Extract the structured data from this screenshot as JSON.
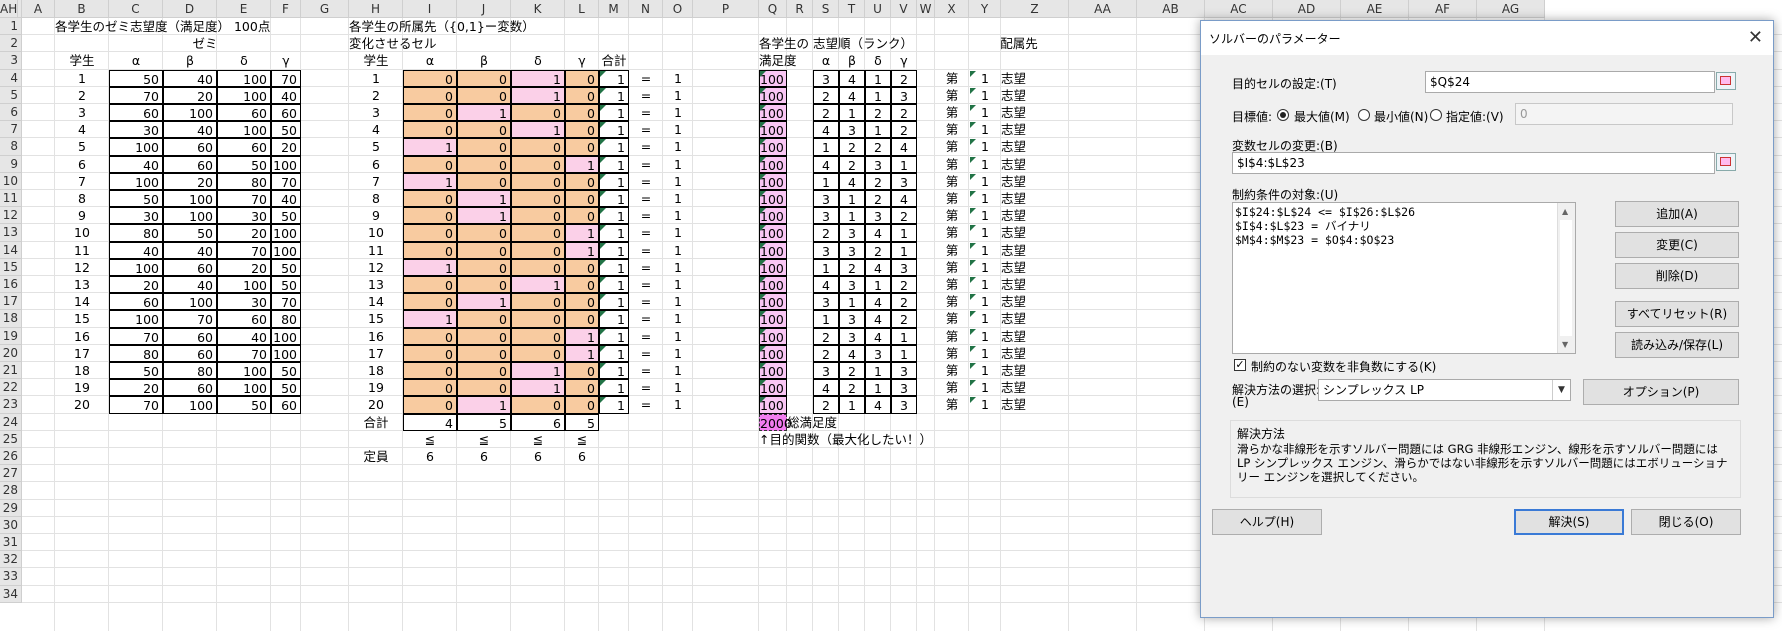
{
  "columns": [
    "A",
    "B",
    "C",
    "D",
    "E",
    "F",
    "G",
    "H",
    "I",
    "J",
    "K",
    "L",
    "M",
    "N",
    "O",
    "P",
    "Q",
    "R",
    "S",
    "T",
    "U",
    "V",
    "W",
    "X",
    "Y",
    "Z",
    "AA",
    "AB",
    "AC",
    "AD",
    "AE",
    "AF",
    "AG",
    "AH"
  ],
  "rows": [
    "1",
    "2",
    "3",
    "4",
    "5",
    "6",
    "7",
    "8",
    "9",
    "10",
    "11",
    "12",
    "13",
    "14",
    "15",
    "16",
    "17",
    "18",
    "19",
    "20",
    "21",
    "22",
    "23",
    "24",
    "25",
    "26",
    "27",
    "28",
    "29",
    "30",
    "31",
    "32",
    "33",
    "34"
  ],
  "sheet": {
    "b1_title": "各学生のゼミ志望度（満足度） 100点",
    "zemi": "ゼミ",
    "student_hdr": "学生",
    "greek": [
      "α",
      "β",
      "δ",
      "γ"
    ],
    "preference": [
      [
        50,
        40,
        100,
        70
      ],
      [
        70,
        20,
        100,
        40
      ],
      [
        60,
        100,
        60,
        60
      ],
      [
        30,
        40,
        100,
        50
      ],
      [
        100,
        60,
        60,
        20
      ],
      [
        40,
        60,
        50,
        100
      ],
      [
        100,
        20,
        80,
        70
      ],
      [
        50,
        100,
        70,
        40
      ],
      [
        30,
        100,
        30,
        50
      ],
      [
        80,
        50,
        20,
        100
      ],
      [
        40,
        40,
        70,
        100
      ],
      [
        100,
        60,
        20,
        50
      ],
      [
        20,
        40,
        100,
        50
      ],
      [
        60,
        100,
        30,
        70
      ],
      [
        100,
        70,
        60,
        80
      ],
      [
        70,
        60,
        40,
        100
      ],
      [
        80,
        60,
        70,
        100
      ],
      [
        50,
        80,
        100,
        50
      ],
      [
        20,
        60,
        100,
        50
      ],
      [
        70,
        100,
        50,
        60
      ]
    ],
    "h1_title": "各学生の所属先（{0,1}ー変数）",
    "h2_label": "変化させるセル",
    "student_hdr2": "学生",
    "goukei": "合計",
    "assignment": [
      [
        0,
        0,
        1,
        0
      ],
      [
        0,
        0,
        1,
        0
      ],
      [
        0,
        1,
        0,
        0
      ],
      [
        0,
        0,
        1,
        0
      ],
      [
        1,
        0,
        0,
        0
      ],
      [
        0,
        0,
        0,
        1
      ],
      [
        1,
        0,
        0,
        0
      ],
      [
        0,
        1,
        0,
        0
      ],
      [
        0,
        1,
        0,
        0
      ],
      [
        0,
        0,
        0,
        1
      ],
      [
        0,
        0,
        0,
        1
      ],
      [
        1,
        0,
        0,
        0
      ],
      [
        0,
        0,
        1,
        0
      ],
      [
        0,
        1,
        0,
        0
      ],
      [
        1,
        0,
        0,
        0
      ],
      [
        0,
        0,
        0,
        1
      ],
      [
        0,
        0,
        0,
        1
      ],
      [
        0,
        0,
        1,
        0
      ],
      [
        0,
        0,
        1,
        0
      ],
      [
        0,
        1,
        0,
        0
      ]
    ],
    "row_sum": "1",
    "eq": "=",
    "one": "1",
    "col_totals": [
      4,
      5,
      6,
      5
    ],
    "goukei_row": "合計",
    "le": "≦",
    "teiin": "定員",
    "capacity": [
      6,
      6,
      6,
      6
    ],
    "q2": "各学生の",
    "q3": "満足度",
    "satisfaction": "100",
    "total": "2000",
    "total_label": "総満足度",
    "objective_note": "↑目的関数（最大化したい！）",
    "s2": "志望順（ランク）",
    "rank": [
      [
        3,
        4,
        1,
        2
      ],
      [
        2,
        4,
        1,
        3
      ],
      [
        2,
        1,
        2,
        2
      ],
      [
        4,
        3,
        1,
        2
      ],
      [
        1,
        2,
        2,
        4
      ],
      [
        4,
        2,
        3,
        1
      ],
      [
        1,
        4,
        2,
        3
      ],
      [
        3,
        1,
        2,
        4
      ],
      [
        3,
        1,
        3,
        2
      ],
      [
        2,
        3,
        4,
        1
      ],
      [
        3,
        3,
        2,
        1
      ],
      [
        1,
        2,
        4,
        3
      ],
      [
        4,
        3,
        1,
        2
      ],
      [
        3,
        1,
        4,
        2
      ],
      [
        1,
        3,
        4,
        2
      ],
      [
        2,
        3,
        4,
        1
      ],
      [
        2,
        4,
        3,
        1
      ],
      [
        3,
        2,
        1,
        3
      ],
      [
        4,
        2,
        1,
        3
      ],
      [
        2,
        1,
        4,
        3
      ]
    ],
    "y2": "配属先",
    "dai": "第",
    "shibou": "志望"
  },
  "dialog": {
    "title": "ソルバーのパラメーター",
    "target_label": "目的セルの設定:(T)",
    "target_value": "$Q$24",
    "goal_label": "目標値:",
    "opt_max": "最大値(M)",
    "opt_min": "最小値(N)",
    "opt_value": "指定値:(V)",
    "value_field": "0",
    "var_label": "変数セルの変更:(B)",
    "var_value": "$I$4:$L$23",
    "constraint_label": "制約条件の対象:(U)",
    "constraints": [
      "$I$24:$L$24 <= $I$26:$L$26",
      "$I$4:$L$23 = バイナリ",
      "$M$4:$M$23 = $O$4:$O$23"
    ],
    "btn_add": "追加(A)",
    "btn_change": "変更(C)",
    "btn_delete": "削除(D)",
    "btn_reset": "すべてリセット(R)",
    "btn_load": "読み込み/保存(L)",
    "nonneg_label": "制約のない変数を非負数にする(K)",
    "method_label": "解決方法の選択:",
    "method_label2": "(E)",
    "method_value": "シンプレックス LP",
    "btn_options": "オプション(P)",
    "method_group": "解決方法",
    "method_desc": "滑らかな非線形を示すソルバー問題には GRG 非線形エンジン、線形を示すソルバー問題には LP シンプレックス エンジン、滑らかではない非線形を示すソルバー問題にはエボリューショナリー エンジンを選択してください。",
    "btn_help": "ヘルプ(H)",
    "btn_solve": "解決(S)",
    "btn_close": "閉じる(O)"
  }
}
